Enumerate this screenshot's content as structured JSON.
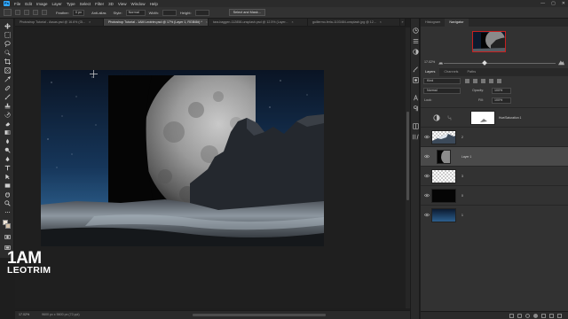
{
  "app": {
    "logo_text": "Ps"
  },
  "menu": [
    "File",
    "Edit",
    "Image",
    "Layer",
    "Type",
    "Select",
    "Filter",
    "3D",
    "View",
    "Window",
    "Help"
  ],
  "window_controls": {
    "minimize": "—",
    "maximize": "▢",
    "close": "✕"
  },
  "options_bar": {
    "feather_label": "Feather:",
    "feather_value": "0 px",
    "antialias_label": "Anti-alias",
    "style_label": "Style:",
    "style_value": "Normal",
    "width_label": "Width:",
    "height_label": "Height:",
    "select_mask_button": "Select and Mask..."
  },
  "tabs": [
    {
      "label": "Photoshop Tutorial - Assas.psd @ 16.6% (Gl...",
      "active": false
    },
    {
      "label": "Photoshop Tutorial - 1AM Leotrim.psd @ 17% (Layer 1, RGB/8#) *",
      "active": true
    },
    {
      "label": "tara-baggen-112858-unsplash.psd @ 12.5% (Layer...",
      "active": false
    },
    {
      "label": "guillermo-ferla-1103484-unsplash.jpg @ 12...",
      "active": false
    }
  ],
  "status_bar": {
    "zoom": "17.02%",
    "doc_info": "9600 px x 5600 px (72 ppi)"
  },
  "navigator": {
    "tabs": [
      "Histogram",
      "Navigator"
    ],
    "zoom_value": "17.02%"
  },
  "layers_panel": {
    "tabs": [
      "Layers",
      "Channels",
      "Paths"
    ],
    "filter_kind": "Kind",
    "blend_mode": "Normal",
    "opacity_label": "Opacity:",
    "opacity_value": "100%",
    "lock_label": "Lock:",
    "fill_label": "Fill:",
    "fill_value": "100%",
    "layers": [
      {
        "name": "Hue/Saturation 1",
        "selected": false,
        "kind": "adjustment",
        "visible": false
      },
      {
        "name": "2",
        "selected": false,
        "kind": "mountain",
        "visible": true
      },
      {
        "name": "Layer 1",
        "selected": true,
        "kind": "moon",
        "visible": true
      },
      {
        "name": "3",
        "selected": false,
        "kind": "transparent",
        "visible": true
      },
      {
        "name": "0",
        "selected": false,
        "kind": "dark",
        "visible": true
      },
      {
        "name": "1",
        "selected": false,
        "kind": "sky",
        "visible": true
      }
    ]
  },
  "watermark": {
    "line1": "1AM",
    "line2": "LEOTRIM"
  },
  "colors": {
    "accent": "#31a8ff",
    "panel_bg": "#323232",
    "selected_layer": "#4a4a4a",
    "foreground_swatch": "#f0e6d8",
    "background_swatch": "#d4c1a8"
  }
}
